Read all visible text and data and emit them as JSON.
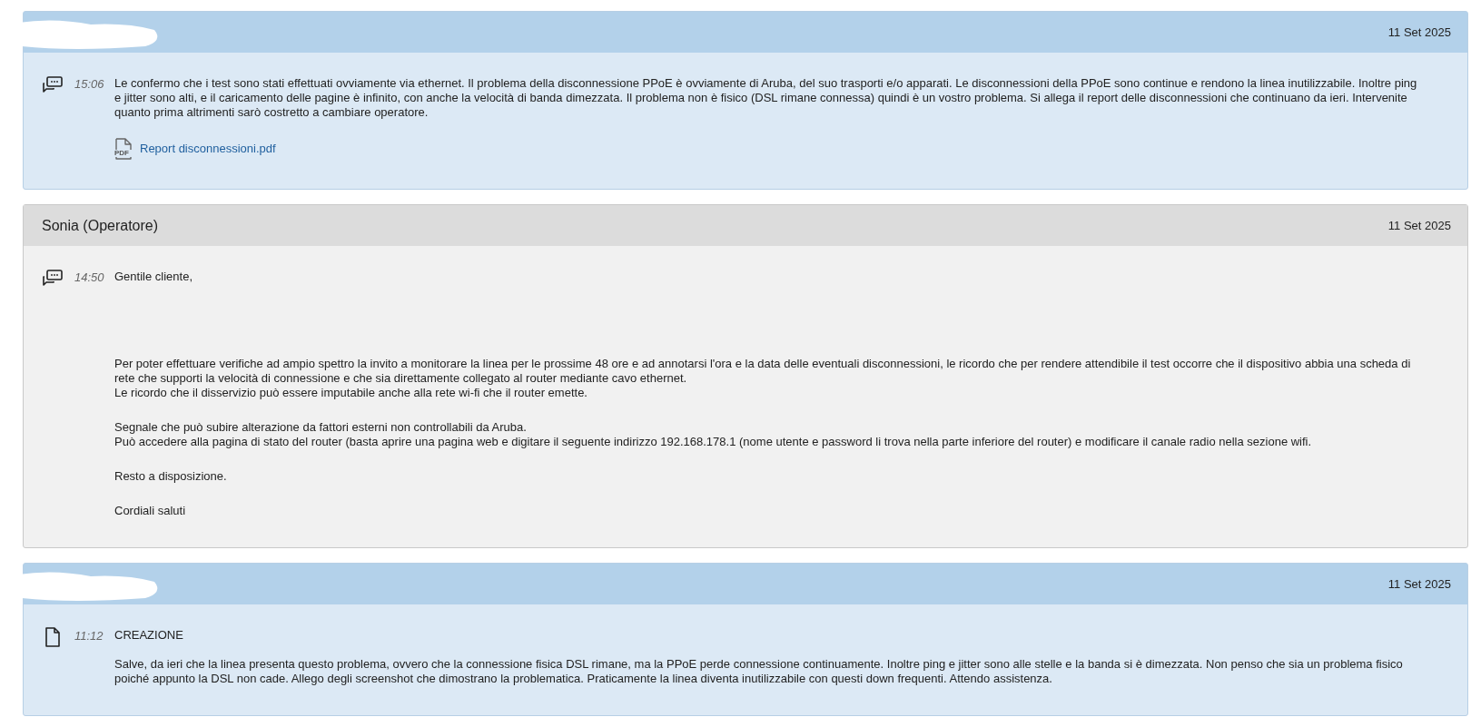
{
  "messages": [
    {
      "kind": "customer_reply",
      "date": "11 Set 2025",
      "time": "15:06",
      "paragraphs": [
        "Le confermo che i test sono stati effettuati ovviamente via ethernet. Il problema della disconnessione PPoE è ovviamente di Aruba, del suo trasporti e/o apparati. Le disconnessioni della PPoE sono continue e rendono la linea inutilizzabile. Inoltre ping e jitter sono alti, e il caricamento delle pagine è infinito, con anche la velocità di banda dimezzata. Il problema non è fisico (DSL rimane connessa) quindi è un vostro problema. Si allega il report delle disconnessioni che continuano da ieri. Intervenite quanto prima altrimenti sarò costretto a cambiare operatore."
      ],
      "attachments": [
        {
          "type_label": "PDF",
          "name": "Report disconnessioni.pdf"
        }
      ]
    },
    {
      "kind": "operator_reply",
      "author": "Sonia (Operatore)",
      "date": "11 Set 2025",
      "time": "14:50",
      "paragraphs": [
        "Gentile cliente,",
        "Per poter effettuare verifiche ad ampio spettro la invito a monitorare la linea per le prossime 48 ore e ad annotarsi l'ora e la data delle eventuali disconnessioni, le ricordo che per rendere attendibile il test occorre che il dispositivo abbia una scheda di rete che supporti la velocità di connessione e che sia direttamente collegato al router mediante cavo ethernet.\nLe ricordo che il disservizio può essere imputabile anche alla rete wi-fi che il router emette.",
        "Segnale che può subire alterazione da fattori esterni non controllabili da Aruba.\nPuò accedere alla pagina di stato del router (basta aprire una pagina web e digitare il seguente indirizzo 192.168.178.1 (nome utente e password li trova nella parte inferiore del router) e modificare il canale radio nella sezione wifi.",
        "Resto a disposizione.",
        "Cordiali saluti"
      ]
    },
    {
      "kind": "creation",
      "date": "11 Set 2025",
      "time": "11:12",
      "paragraphs": [
        "CREAZIONE",
        "Salve, da ieri che la linea presenta questo problema, ovvero che la connessione fisica DSL rimane, ma la PPoE perde connessione continuamente. Inoltre ping e jitter sono alle stelle e la banda si è dimezzata. Non penso che sia un problema fisico poiché appunto la DSL non cade. Allego degli screenshot che dimostrano la problematica. Praticamente la linea diventa inutilizzabile con questi down frequenti. Attendo assistenza."
      ]
    }
  ]
}
